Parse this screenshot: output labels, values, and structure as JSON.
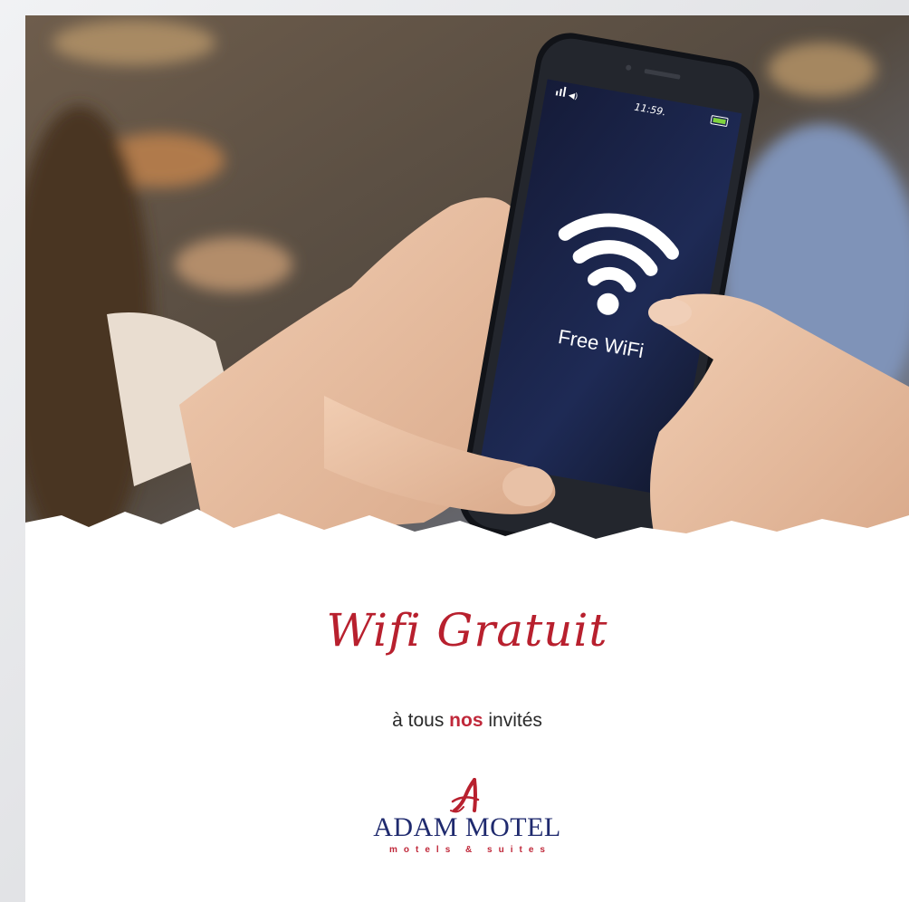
{
  "phone": {
    "status_time": "11:59.",
    "screen_text": "Free WiFi"
  },
  "headline": "Wifi Gratuit",
  "subline": {
    "before": "à tous",
    "accent": "nos",
    "after": "invités"
  },
  "logo": {
    "name": "Adam Motel",
    "tagline": "motels & suites"
  },
  "colors": {
    "accent": "#b8202e",
    "brand_navy": "#1f2a6e",
    "phone_screen": "#1a2245"
  }
}
